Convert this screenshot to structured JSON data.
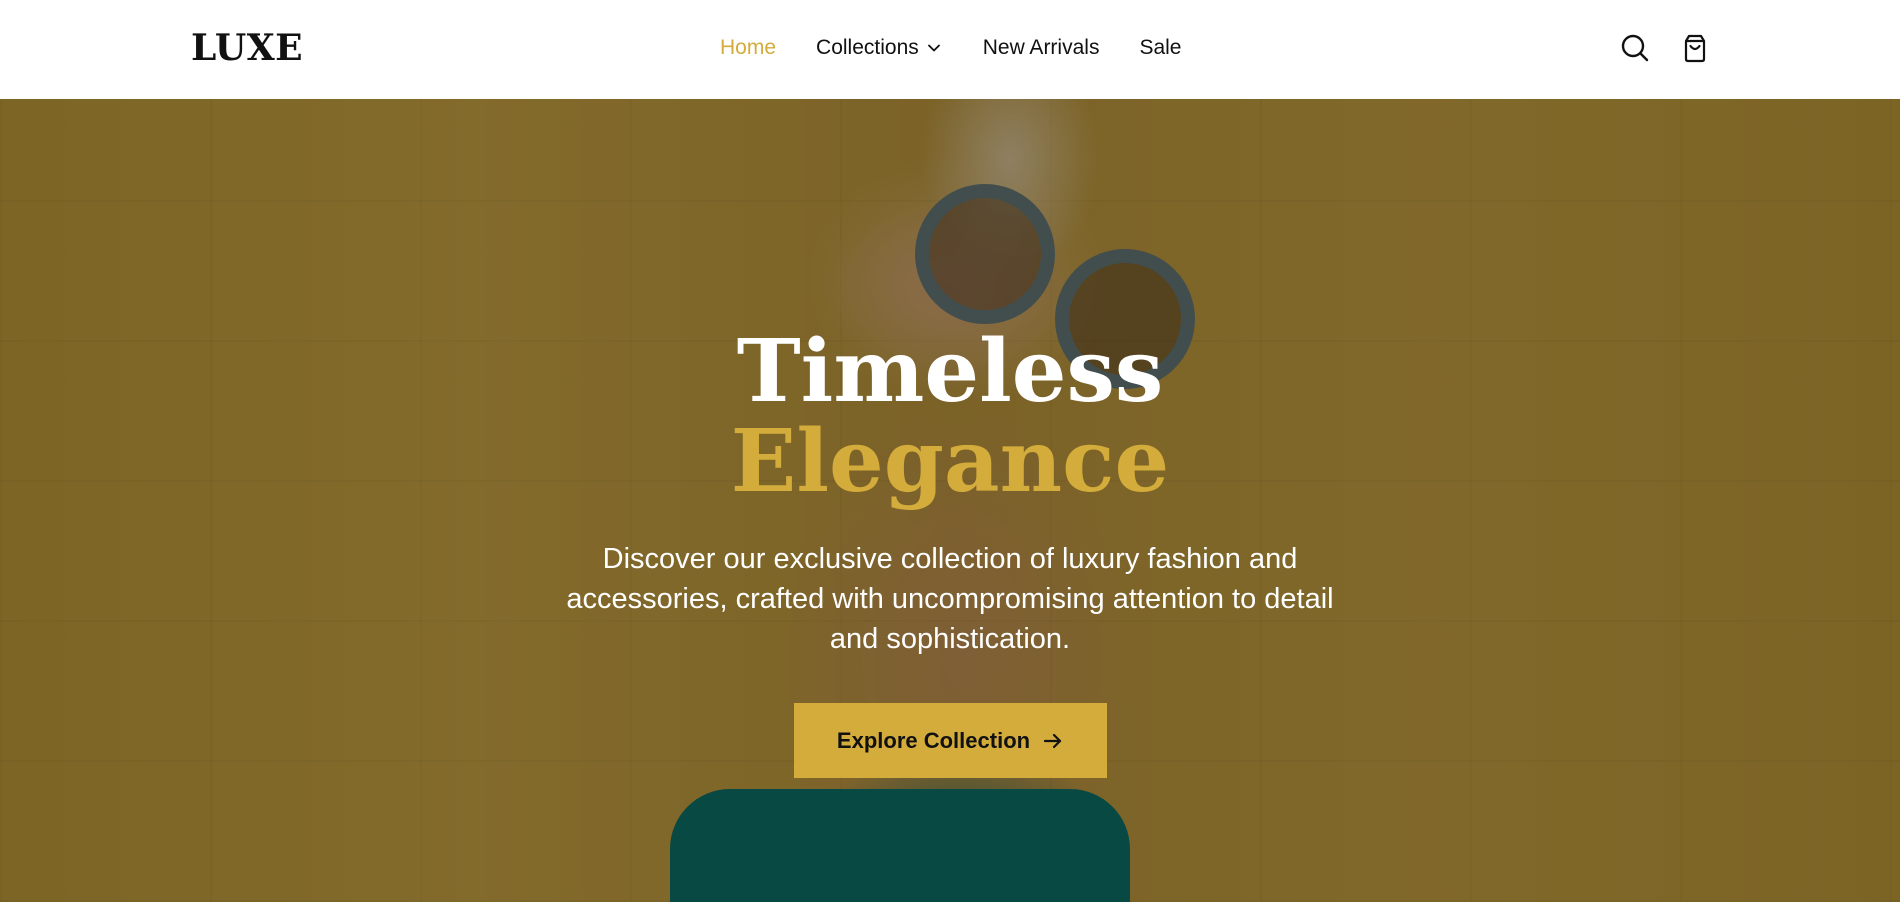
{
  "header": {
    "logo": "LUXE",
    "nav": [
      {
        "label": "Home",
        "active": true
      },
      {
        "label": "Collections",
        "has_dropdown": true
      },
      {
        "label": "New Arrivals"
      },
      {
        "label": "Sale"
      }
    ],
    "icons": [
      "search-icon",
      "shopping-bag-icon"
    ]
  },
  "hero": {
    "title_line1": "Timeless",
    "title_line2": "Elegance",
    "description": "Discover our exclusive collection of luxury fashion and accessories, crafted with uncompromising attention to detail and sophistication.",
    "cta_label": "Explore Collection",
    "cta_icon": "arrow-right-icon"
  },
  "colors": {
    "accent": "#d4ac3b",
    "text_dark": "#111111",
    "header_bg": "#ffffff",
    "hero_text": "#ffffff"
  }
}
